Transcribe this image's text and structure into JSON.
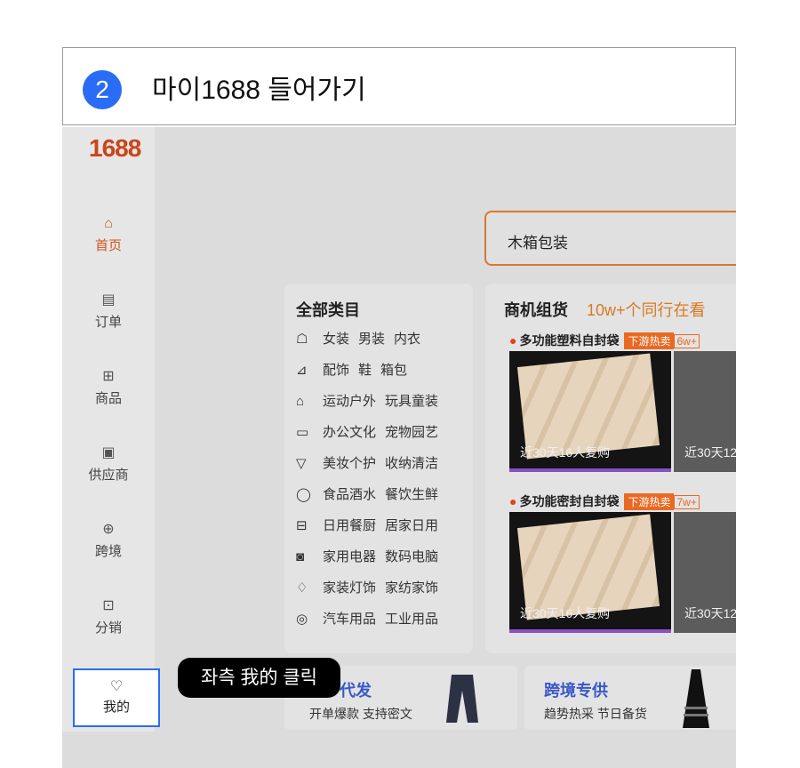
{
  "step": {
    "number": "2",
    "title": "마이1688 들어가기"
  },
  "app": {
    "logo": "1688"
  },
  "sidebar": {
    "items": [
      {
        "label": "首页",
        "icon": "home-icon"
      },
      {
        "label": "订单",
        "icon": "order-icon"
      },
      {
        "label": "商品",
        "icon": "grid-icon"
      },
      {
        "label": "供应商",
        "icon": "supplier-icon"
      },
      {
        "label": "跨境",
        "icon": "globe-icon"
      },
      {
        "label": "分销",
        "icon": "distribution-icon"
      },
      {
        "label": "我的",
        "icon": "me-icon"
      }
    ]
  },
  "search": {
    "value": "木箱包装"
  },
  "categories": {
    "title": "全部类目",
    "rows": [
      {
        "a": "女装",
        "b": "男装",
        "c": "内衣"
      },
      {
        "a": "配饰",
        "b": "鞋",
        "c": "箱包"
      },
      {
        "a": "运动户外",
        "b": "玩具童装"
      },
      {
        "a": "办公文化",
        "b": "宠物园艺"
      },
      {
        "a": "美妆个护",
        "b": "收纳清洁"
      },
      {
        "a": "食品酒水",
        "b": "餐饮生鲜"
      },
      {
        "a": "日用餐厨",
        "b": "居家日用"
      },
      {
        "a": "家用电器",
        "b": "数码电脑"
      },
      {
        "a": "家装灯饰",
        "b": "家纺家饰"
      },
      {
        "a": "汽车用品",
        "b": "工业用品"
      }
    ]
  },
  "deals": {
    "title": "商机组货",
    "subtitle": "10w+个同行在看",
    "items": [
      {
        "name": "多功能塑料自封袋",
        "badge": "下游热卖",
        "count": "6w+",
        "caption": "近30天16人复购",
        "caption2": "近30天12"
      },
      {
        "name": "多功能密封自封袋",
        "badge": "下游热卖",
        "count": "7w+",
        "caption": "近30天16人复购",
        "caption2": "近30天12"
      }
    ]
  },
  "bottom": [
    {
      "title": "代发",
      "sub": "开单爆款 支持密文"
    },
    {
      "title": "跨境专供",
      "sub": "趋势热采 节日备货"
    }
  ],
  "tooltip": {
    "text": "좌측 我的 클릭"
  }
}
